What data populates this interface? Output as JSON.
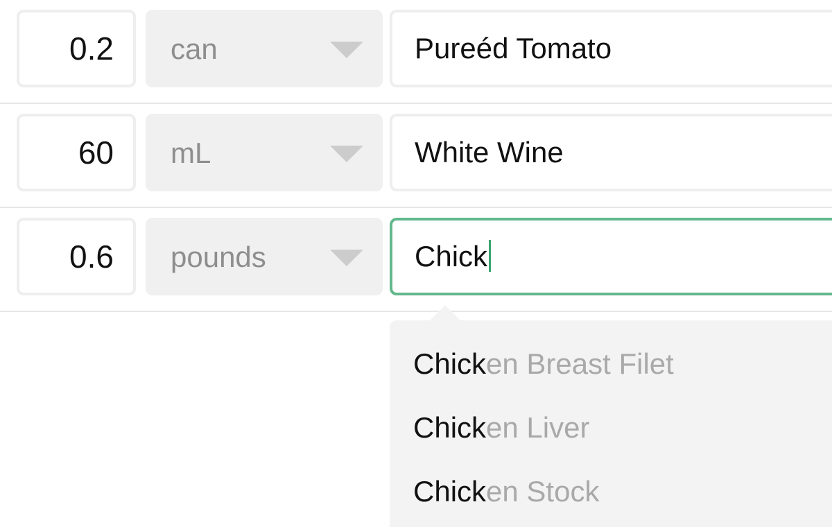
{
  "ingredients": [
    {
      "quantity": "0.2",
      "unit": "can",
      "name": "Pureéd Tomato"
    },
    {
      "quantity": "60",
      "unit": "mL",
      "name": "White Wine"
    },
    {
      "quantity": "0.6",
      "unit": "pounds",
      "name": "Chick"
    }
  ],
  "autocomplete": {
    "query": "Chick",
    "suggestions": [
      {
        "match": "Chick",
        "rest": "en Breast Filet"
      },
      {
        "match": "Chick",
        "rest": "en Liver"
      },
      {
        "match": "Chick",
        "rest": "en Stock"
      }
    ]
  },
  "colors": {
    "focus_border": "#62b88c",
    "unit_background": "#f0f0f0",
    "suggestion_background": "#f3f3f3",
    "suggestion_rest_text": "#a9a9a9"
  },
  "icons": {
    "unit_dropdown": "chevron-down-icon"
  }
}
